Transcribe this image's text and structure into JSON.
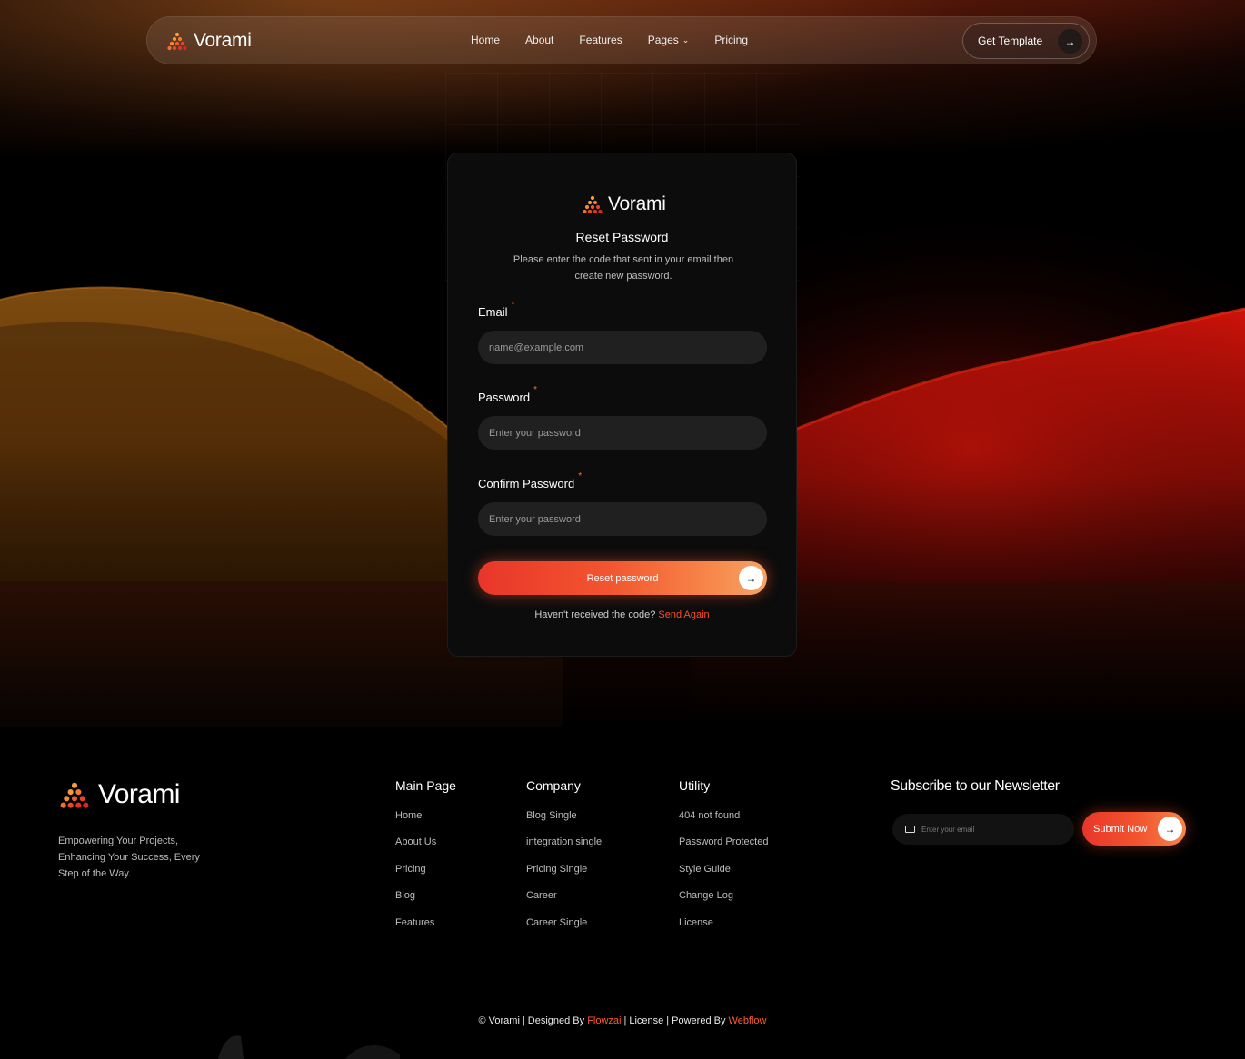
{
  "brand": {
    "name": "Vorami"
  },
  "colors": {
    "accent": "#ff5a2e",
    "card_bg": "#0c0c0c",
    "input_bg": "#202020",
    "page_bg": "#000000"
  },
  "nav": {
    "links": [
      "Home",
      "About",
      "Features",
      "Pages",
      "Pricing"
    ],
    "cta_label": "Get Template"
  },
  "card": {
    "title": "Reset Password",
    "subtitle": "Please enter the code that sent in your email then create new password.",
    "email_label": "Email",
    "email_placeholder": "name@example.com",
    "password_label": "Password",
    "password_placeholder": "Enter your password",
    "confirm_label": "Confirm Password",
    "confirm_placeholder": "Enter your password",
    "required_mark": "*",
    "submit_label": "Reset password",
    "resend_text": "Haven't received the code?",
    "resend_link": "Send Again"
  },
  "footer": {
    "description": "Empowering Your Projects, Enhancing Your Success, Every Step of the Way.",
    "columns": [
      {
        "title": "Main Page",
        "items": [
          "Home",
          "About Us",
          "Pricing",
          "Blog",
          "Features"
        ]
      },
      {
        "title": "Company",
        "items": [
          "Blog Single",
          "integration single",
          "Pricing Single",
          "Career",
          "Career Single"
        ]
      },
      {
        "title": "Utility",
        "items": [
          "404 not found",
          "Password Protected",
          "Style Guide",
          "Change Log",
          "License"
        ]
      }
    ],
    "newsletter_title": "Subscribe to our Newsletter",
    "newsletter_placeholder": "Enter your email",
    "newsletter_button": "Submit Now",
    "copyright": {
      "prefix": "© Vorami",
      "designed_by": "Designed By",
      "designer": "Flowzai",
      "license": "License",
      "powered_by": "Powered By",
      "platform": "Webflow"
    }
  }
}
